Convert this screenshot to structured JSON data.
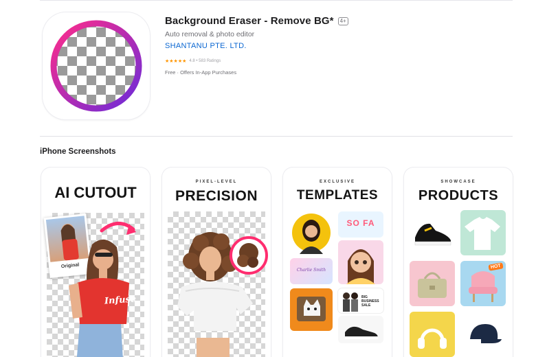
{
  "app": {
    "title": "Background Eraser - Remove BG*",
    "age_rating": "4+",
    "subtitle": "Auto removal & photo editor",
    "developer": "SHANTANU PTE. LTD.",
    "stars": "★★★★★",
    "rating_text": "4.8 • 583 Ratings",
    "price": "Free · Offers In-App Purchases",
    "icon": "checkerboard-ring-icon"
  },
  "screenshots": {
    "section_title": "iPhone Screenshots",
    "items": [
      {
        "headline": "AI CUTOUT",
        "badge": "Original",
        "shirt_text": "Infuse"
      },
      {
        "kicker": "PIXEL-LEVEL",
        "headline": "PRECISION"
      },
      {
        "kicker": "EXCLUSIVE",
        "headline": "TEMPLATES",
        "template_labels": [
          "SO FA",
          "Charlie Smith",
          "BIG BUSINESS SALE"
        ]
      },
      {
        "kicker": "SHOWCASE",
        "headline": "PRODUCTS",
        "hot_label": "HOT"
      }
    ]
  },
  "colors": {
    "accent_link": "#0a66d1",
    "ring_pink": "#ff2d8a",
    "ring_purple": "#6b2bd9",
    "star": "#ff9500"
  }
}
